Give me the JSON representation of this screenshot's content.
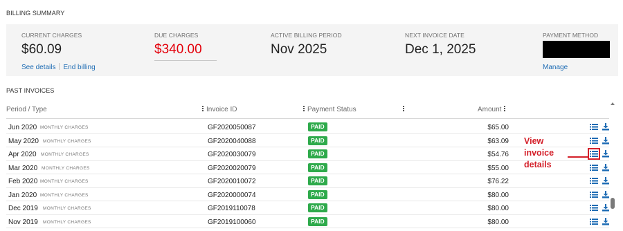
{
  "billing_summary": {
    "title": "BILLING SUMMARY",
    "current_charges": {
      "label": "CURRENT CHARGES",
      "value": "$60.09"
    },
    "links": {
      "see_details": "See details",
      "end_billing": "End billing"
    },
    "due_charges": {
      "label": "DUE CHARGES",
      "value": "$340.00",
      "color": "#e3000b"
    },
    "active_billing_period": {
      "label": "ACTIVE BILLING PERIOD",
      "value": "Nov 2025"
    },
    "next_invoice_date": {
      "label": "NEXT INVOICE DATE",
      "value": "Dec 1, 2025"
    },
    "payment_method": {
      "label": "PAYMENT METHOD",
      "manage_link": "Manage"
    }
  },
  "past_invoices": {
    "title": "PAST INVOICES",
    "columns": {
      "period": "Period / Type",
      "invoice_id": "Invoice ID",
      "payment_status": "Payment Status",
      "amount": "Amount"
    },
    "rows": [
      {
        "period": "Jun 2020",
        "type": "MONTHLY CHARGES",
        "invoice_id": "GF2020050087",
        "status": "PAID",
        "amount": "$65.00"
      },
      {
        "period": "May 2020",
        "type": "MONTHLY CHARGES",
        "invoice_id": "GF2020040088",
        "status": "PAID",
        "amount": "$63.09"
      },
      {
        "period": "Apr 2020",
        "type": "MONTHLY CHARGES",
        "invoice_id": "GF2020030079",
        "status": "PAID",
        "amount": "$54.76"
      },
      {
        "period": "Mar 2020",
        "type": "MONTHLY CHARGES",
        "invoice_id": "GF2020020079",
        "status": "PAID",
        "amount": "$55.00"
      },
      {
        "period": "Feb 2020",
        "type": "MONTHLY CHARGES",
        "invoice_id": "GF2020010072",
        "status": "PAID",
        "amount": "$76.22"
      },
      {
        "period": "Jan 2020",
        "type": "MONTHLY CHARGES",
        "invoice_id": "GF2020000074",
        "status": "PAID",
        "amount": "$80.00"
      },
      {
        "period": "Dec 2019",
        "type": "MONTHLY CHARGES",
        "invoice_id": "GF2019110078",
        "status": "PAID",
        "amount": "$80.00"
      },
      {
        "period": "Nov 2019",
        "type": "MONTHLY CHARGES",
        "invoice_id": "GF2019100060",
        "status": "PAID",
        "amount": "$80.00"
      }
    ],
    "status_color": "#2eaa4b",
    "row_icons": [
      "list-icon",
      "download-icon"
    ]
  },
  "annotation": {
    "line1": "View",
    "line2": "invoice",
    "line3": "details",
    "color": "#d4202a"
  },
  "accent_color": "#1e6cb4"
}
